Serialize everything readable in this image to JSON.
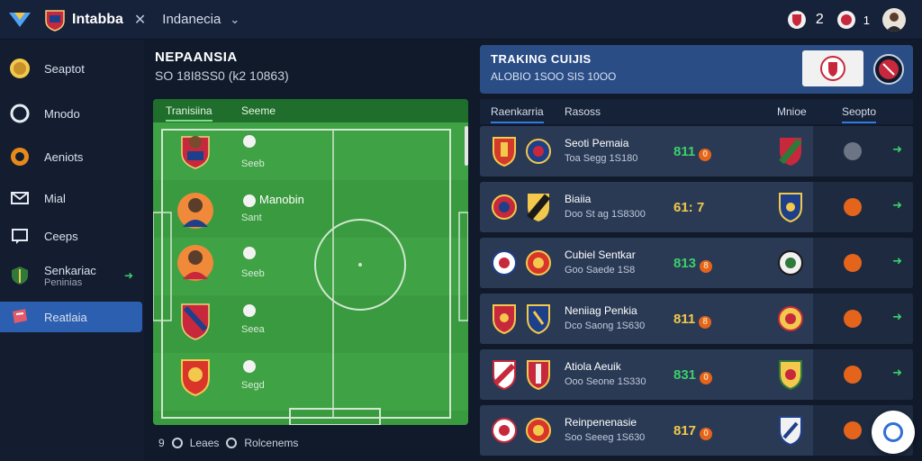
{
  "topbar": {
    "app_title": "Intabba",
    "dropdown_label": "Indanecia",
    "count_one": "2",
    "count_two": "1"
  },
  "sidebar": {
    "items": [
      {
        "label": "Seaptot",
        "icon": "coin-icon"
      },
      {
        "label": "Mnodo",
        "icon": "ring-icon"
      },
      {
        "label": "Aeniots",
        "icon": "target-icon"
      },
      {
        "label": "Mial",
        "icon": "mail-icon"
      },
      {
        "label": "Ceeps",
        "icon": "chat-icon"
      },
      {
        "label": "Senkariac",
        "sublabel": "Peninias",
        "icon": "shield-icon"
      },
      {
        "label": "Reatlaia",
        "icon": "flag-icon"
      }
    ]
  },
  "middle": {
    "title": "NEPAANSIA",
    "subtitle": "SO 18I8SS0 (k2 10863)",
    "tabs": [
      "Tranisiina",
      "Seeme"
    ],
    "players": [
      {
        "name": "",
        "stat": "Seeb"
      },
      {
        "name": "Manobin",
        "stat": "Sant"
      },
      {
        "name": "",
        "stat": "Seeb"
      },
      {
        "name": "",
        "stat": "Seea"
      },
      {
        "name": "",
        "stat": "Segd"
      }
    ],
    "legend": [
      "9",
      "Leaes",
      "Rolcenems"
    ]
  },
  "right": {
    "header_title": "TRAKING CUIJIS",
    "header_sub": "ALOBIO 1SOO  SIS 10OO",
    "columns": [
      "Raenkarria",
      "Rasoss",
      "Mnioe",
      "Seopto"
    ],
    "rows": [
      {
        "name": "Seoti Pemaia",
        "sub": "Toa Segg 1S180",
        "score": "811",
        "score_color": "#3bd06a",
        "status": "gray"
      },
      {
        "name": "Biaiia",
        "sub": "Doo St ag 1S8300",
        "score": "61: 7",
        "score_color": "#f0c94a",
        "status": "orange"
      },
      {
        "name": "Cubiel Sentkar",
        "sub": "Goo Saede 1S8",
        "score": "813",
        "score_color": "#3bd06a",
        "status": "orange"
      },
      {
        "name": "Neniiag Penkia",
        "sub": "Dco Saong 1S630",
        "score": "811",
        "score_color": "#f0c94a",
        "status": "orange"
      },
      {
        "name": "Atiola Aeuik",
        "sub": "Ooo Seone 1S330",
        "score": "831",
        "score_color": "#3bd06a",
        "status": "orange"
      },
      {
        "name": "Reinpenenasie",
        "sub": "Soo Seeeg 1S630",
        "score": "817",
        "score_color": "#f0c94a",
        "status": "orange"
      }
    ]
  }
}
